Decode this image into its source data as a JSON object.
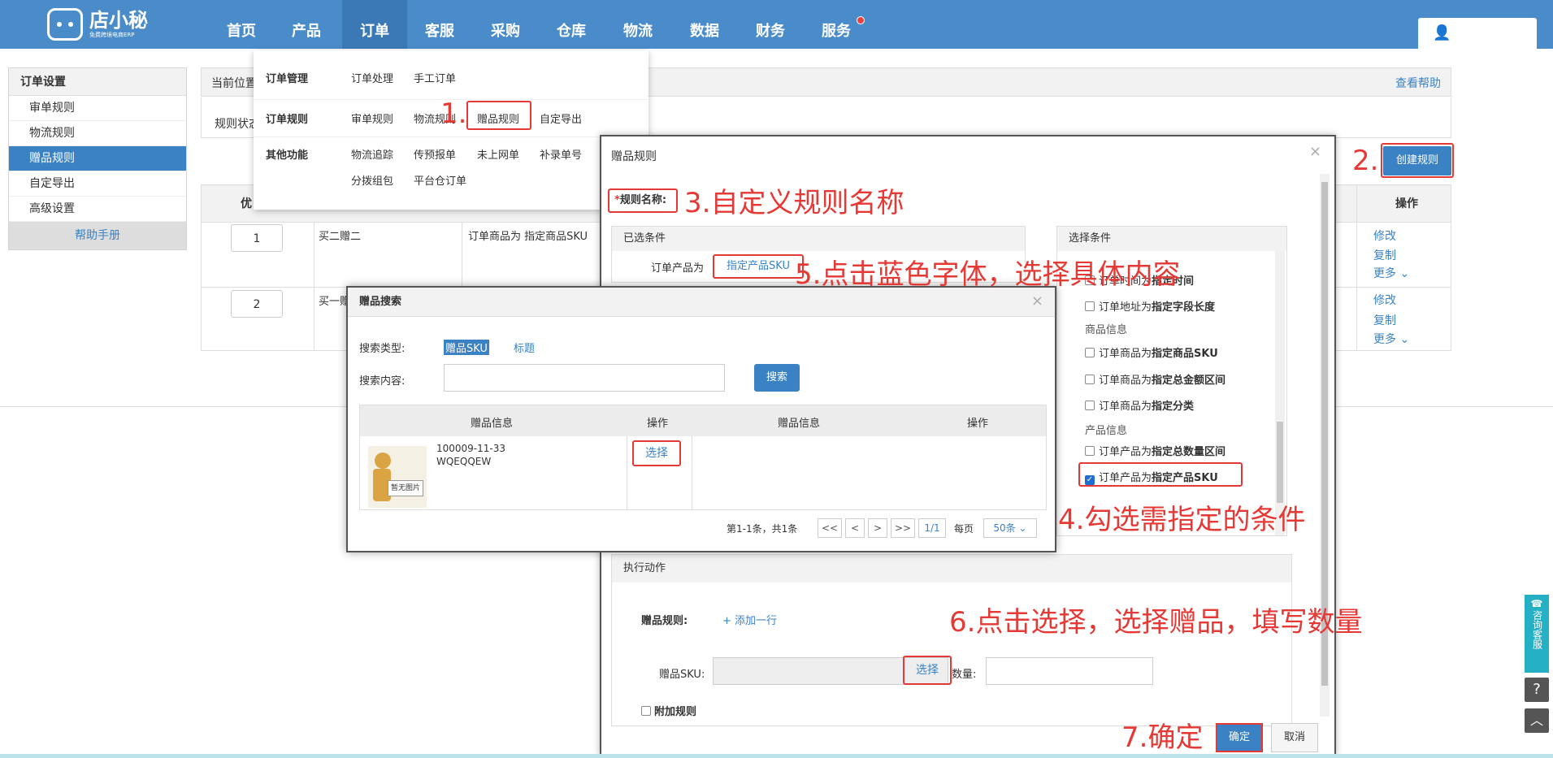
{
  "app": {
    "logo_text": "店小秘",
    "logo_sub": "免费跨境电商ERP"
  },
  "nav": [
    "首页",
    "产品",
    "订单",
    "客服",
    "采购",
    "仓库",
    "物流",
    "数据",
    "财务",
    "服务"
  ],
  "sidebar": {
    "header": "订单设置",
    "items": [
      "审单规则",
      "物流规则",
      "赠品规则",
      "自定导出",
      "高级设置"
    ],
    "footer": "帮助手册",
    "active": "赠品规则"
  },
  "crumb": {
    "label": "当前位置",
    "help": "查看帮助"
  },
  "rulestate": "规则状态",
  "create_button": "创建规则",
  "table": {
    "col_priority": "优",
    "col_op": "操作",
    "rows": [
      {
        "priority": "1",
        "name": "买二赠二",
        "cond": "订单商品为 指定商品SKU",
        "ops": [
          "修改",
          "复制",
          "更多 ⌄"
        ]
      },
      {
        "priority": "2",
        "name": "买一赠",
        "cond": "",
        "ops": [
          "修改",
          "复制",
          "更多 ⌄"
        ]
      }
    ]
  },
  "menu": {
    "groups": [
      {
        "label": "订单管理",
        "items": [
          "订单处理",
          "手工订单"
        ]
      },
      {
        "label": "订单规则",
        "items": [
          "审单规则",
          "物流规则",
          "赠品规则",
          "自定导出"
        ]
      },
      {
        "label": "其他功能",
        "items": [
          "物流追踪",
          "传预报单",
          "未上网单",
          "补录单号",
          "分拨组包",
          "平台仓订单"
        ]
      }
    ]
  },
  "dialog": {
    "title": "赠品规则",
    "name_label": "规则名称:",
    "selected_header": "已选条件",
    "selected_label": "订单产品为",
    "selected_link": "指定产品SKU",
    "cond_header": "选择条件",
    "conditions": [
      {
        "pre": "订单时间为",
        "bold": "指定时间",
        "checked": false
      },
      {
        "pre": "订单地址为",
        "bold": "指定字段长度",
        "checked": false
      },
      {
        "group": "商品信息"
      },
      {
        "pre": "订单商品为",
        "bold": "指定商品SKU",
        "checked": false
      },
      {
        "pre": "订单商品为",
        "bold": "指定总金额区间",
        "checked": false
      },
      {
        "pre": "订单商品为",
        "bold": "指定分类",
        "checked": false
      },
      {
        "group": "产品信息"
      },
      {
        "pre": "订单产品为",
        "bold": "指定总数量区间",
        "checked": false
      },
      {
        "pre": "订单产品为",
        "bold": "指定产品SKU",
        "checked": true
      }
    ],
    "action_header": "执行动作",
    "gift_rule_label": "赠品规则:",
    "add_row": "+ 添加一行",
    "sku_label": "赠品SKU:",
    "select": "选择",
    "qty_label": "数量:",
    "extra_rule": "附加规则",
    "ok": "确定",
    "cancel": "取消"
  },
  "search": {
    "title": "赠品搜索",
    "type_label": "搜索类型:",
    "type_sku": "赠品SKU",
    "type_title": "标题",
    "content_label": "搜索内容:",
    "search_btn": "搜索",
    "cols": [
      "赠品信息",
      "操作",
      "赠品信息",
      "操作"
    ],
    "item_sku": "100009-11-33",
    "item_title": "WQEQQEW",
    "no_image": "暂无图片",
    "select": "选择",
    "pager": {
      "summary": "第1-1条，共1条",
      "first": "<<",
      "prev": "<",
      "next": ">",
      "last": ">>",
      "page": "1/1",
      "per_label": "每页",
      "per_value": "50条"
    }
  },
  "annotations": [
    "1.",
    "2.",
    "3.自定义规则名称",
    "4.勾选需指定的条件",
    "5.点击蓝色字体，选择具体内容",
    "6.点击选择，选择赠品，填写数量",
    "7.确定"
  ],
  "float": {
    "consult": "咨询客服"
  }
}
